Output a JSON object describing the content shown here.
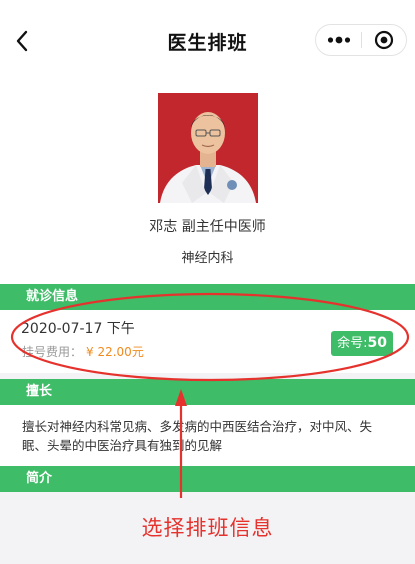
{
  "nav": {
    "title": "医生排班",
    "back_icon": "chevron-left-icon",
    "more_icon": "more-dots-icon",
    "close_icon": "target-close-icon"
  },
  "doctor": {
    "name_title": "邓志 副主任中医师",
    "department": "神经内科"
  },
  "sections": {
    "schedule": "就诊信息",
    "speciality": "擅长",
    "intro": "简介"
  },
  "schedule": {
    "date": "2020-07-17 下午",
    "fee_label": "挂号费用：",
    "fee_value": "¥ 22.00元",
    "remaining_label": "余号:",
    "remaining_count": "50"
  },
  "speciality_text": "擅长对神经内科常见病、多发病的中西医结合治疗，对中风、失眠、头晕的中医治疗具有独到的见解",
  "annotation": {
    "text": "选择排班信息",
    "color": "#e5322d"
  },
  "colors": {
    "accent": "#3ebc67",
    "price": "#f08a1e"
  }
}
